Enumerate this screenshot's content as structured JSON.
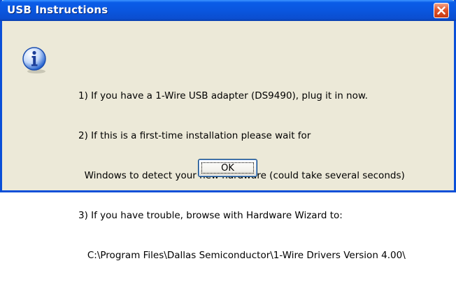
{
  "window": {
    "title": "USB Instructions"
  },
  "icons": {
    "title_close": "close-icon",
    "message_icon": "info-icon"
  },
  "colors": {
    "titlebar": "#0a56df",
    "dialog_background": "#ece9d8",
    "close_button": "#e0542a",
    "info_icon": "#2a66d0"
  },
  "message": {
    "lines": [
      "1) If you have a 1-Wire USB adapter (DS9490), plug it in now.",
      "2) If this is a first-time installation please wait for",
      "  Windows to detect your new hardware (could take several seconds)",
      "3) If you have trouble, browse with Hardware Wizard to:",
      "   C:\\Program Files\\Dallas Semiconductor\\1-Wire Drivers Version 4.00\\"
    ]
  },
  "buttons": {
    "ok_label": "OK"
  }
}
